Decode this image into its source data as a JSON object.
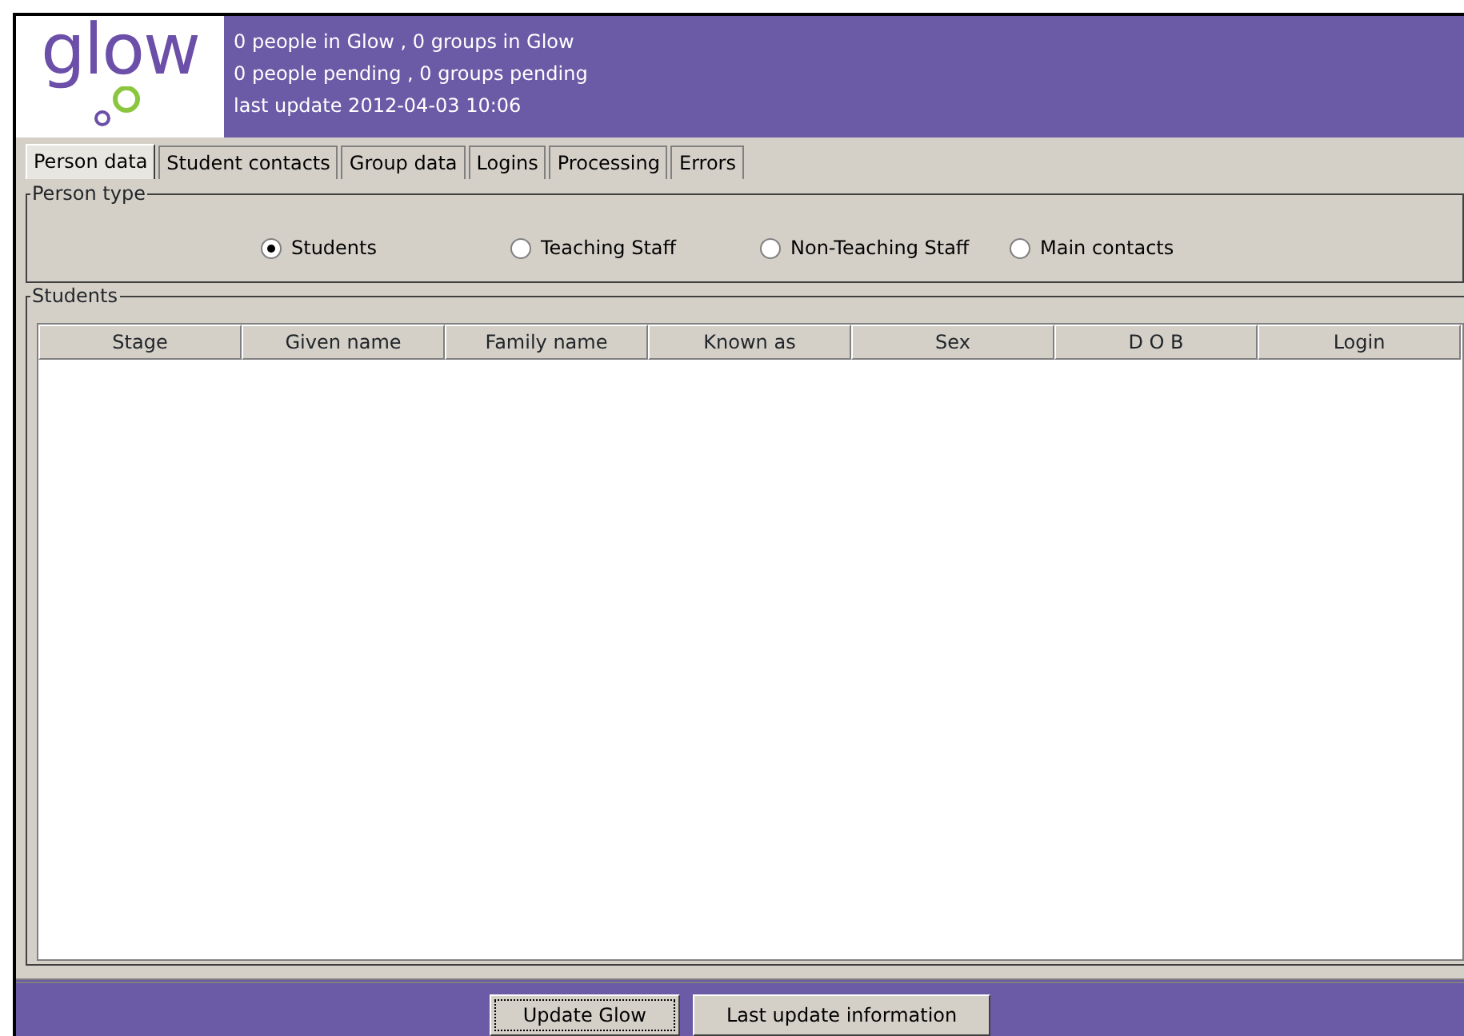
{
  "header": {
    "logo": "glow",
    "lines": [
      "0 people in Glow  , 0 groups in Glow",
      "0 people  pending  , 0 groups pending",
      "last update 2012-04-03 10:06"
    ]
  },
  "tabs": [
    {
      "label": "Person data",
      "selected": true
    },
    {
      "label": "Student contacts",
      "selected": false
    },
    {
      "label": "Group data",
      "selected": false
    },
    {
      "label": "Logins",
      "selected": false
    },
    {
      "label": "Processing",
      "selected": false
    },
    {
      "label": "Errors",
      "selected": false
    }
  ],
  "person_type": {
    "title": "Person type",
    "options": [
      {
        "label": "Students",
        "selected": true
      },
      {
        "label": "Teaching Staff",
        "selected": false
      },
      {
        "label": "Non-Teaching Staff",
        "selected": false
      },
      {
        "label": "Main contacts",
        "selected": false
      }
    ]
  },
  "students": {
    "title": "Students",
    "columns": [
      "Stage",
      "Given name",
      "Family name",
      "Known as",
      "Sex",
      "D O B",
      "Login"
    ]
  },
  "buttons": [
    {
      "label": "Update Glow",
      "focused": true
    },
    {
      "label": "Last update information",
      "focused": false
    }
  ]
}
